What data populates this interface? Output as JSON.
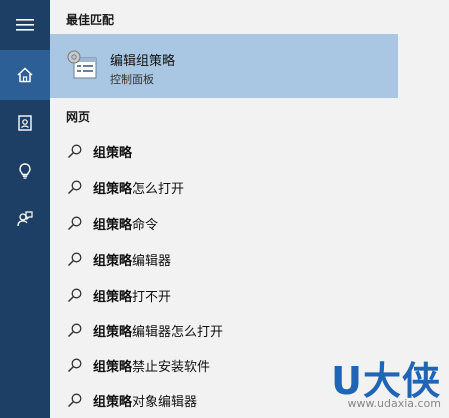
{
  "sidebar": {
    "items": [
      {
        "name": "menu",
        "icon": "hamburger-menu-icon"
      },
      {
        "name": "home",
        "icon": "home-icon"
      },
      {
        "name": "notebook",
        "icon": "notebook-icon"
      },
      {
        "name": "reminders",
        "icon": "lightbulb-icon"
      },
      {
        "name": "feedback",
        "icon": "feedback-icon"
      }
    ]
  },
  "results": {
    "best_match_header": "最佳匹配",
    "best_match": {
      "title": "编辑组策略",
      "subtitle": "控制面板",
      "icon": "group-policy-editor-icon"
    },
    "web_header": "网页",
    "web": [
      {
        "bold": "组策略",
        "rest": ""
      },
      {
        "bold": "组策略",
        "rest": "怎么打开"
      },
      {
        "bold": "组策略",
        "rest": "命令"
      },
      {
        "bold": "组策略",
        "rest": "编辑器"
      },
      {
        "bold": "组策略",
        "rest": "打不开"
      },
      {
        "bold": "组策略",
        "rest": "编辑器怎么打开"
      },
      {
        "bold": "组策略",
        "rest": "禁止安装软件"
      },
      {
        "bold": "组策略",
        "rest": "对象编辑器"
      }
    ]
  },
  "watermark": {
    "main": "U大侠",
    "url": "www.udaxia.com"
  },
  "colors": {
    "rail": "#1d3f66",
    "rail_active": "#2b5f96",
    "selected": "#a9c7e2",
    "panel": "#f2f2f2",
    "watermark": "#1f64b5"
  }
}
